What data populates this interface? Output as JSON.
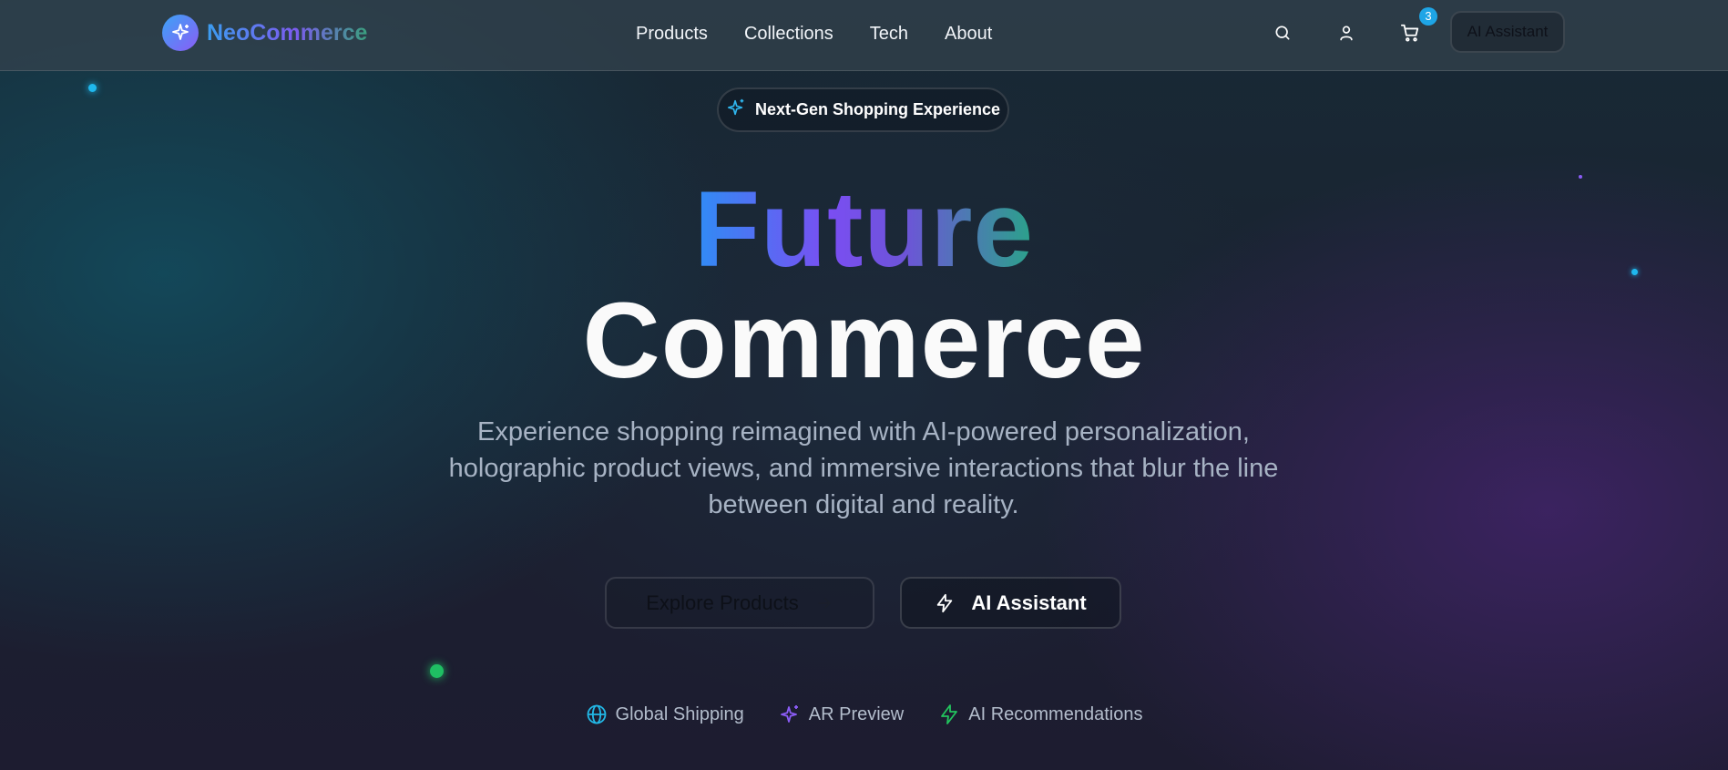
{
  "brand": {
    "name": "NeoCommerce",
    "logo_icon": "sparkles-icon"
  },
  "nav": {
    "links": [
      "Products",
      "Collections",
      "Tech",
      "About"
    ],
    "icons": [
      "search-icon",
      "user-icon",
      "cart-icon"
    ],
    "cart_count": "3",
    "ai_button": "AI Assistant"
  },
  "hero": {
    "badge": "Next-Gen Shopping Experience",
    "badge_icon": "sparkles-icon",
    "title_line1": "Future",
    "title_line2": "Commerce",
    "subtitle": "Experience shopping reimagined with AI-powered personalization, holographic product views, and immersive interactions that blur the line between digital and reality.",
    "primary_button": "Explore Products",
    "primary_button_icon": "arrow-right-icon",
    "secondary_button": "AI Assistant",
    "secondary_button_icon": "zap-icon"
  },
  "features": [
    {
      "label": "Global Shipping",
      "icon": "globe-icon",
      "color": "#22b8e6"
    },
    {
      "label": "AR Preview",
      "icon": "sparkles-icon",
      "color": "#8b5cf6"
    },
    {
      "label": "AI Recommendations",
      "icon": "zap-icon",
      "color": "#22c55e"
    }
  ],
  "colors": {
    "accent_blue": "#2f8df5",
    "accent_purple": "#7a4ef2",
    "accent_teal": "#2aa38a",
    "badge": "#1ea5e6"
  }
}
